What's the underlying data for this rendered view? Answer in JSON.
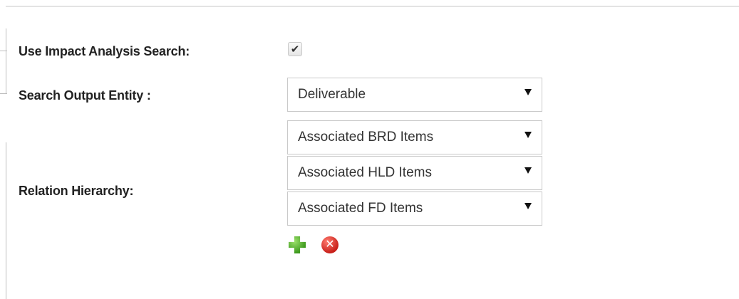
{
  "form": {
    "impact_search": {
      "label": "Use Impact Analysis Search:",
      "checked": true,
      "check_glyph": "✔"
    },
    "output_entity": {
      "label": "Search Output Entity :",
      "selected": "Deliverable"
    },
    "relation_hierarchy": {
      "label": "Relation Hierarchy:",
      "levels": [
        {
          "selected": "Associated BRD Items"
        },
        {
          "selected": "Associated HLD Items"
        },
        {
          "selected": "Associated FD Items"
        }
      ],
      "add_icon": "green-plus-icon",
      "remove_icon": "red-x-icon",
      "remove_glyph": "✕"
    }
  },
  "colors": {
    "add_icon": "#3e9a1e",
    "remove_icon": "#c8201a",
    "border": "#c9c9c9"
  }
}
